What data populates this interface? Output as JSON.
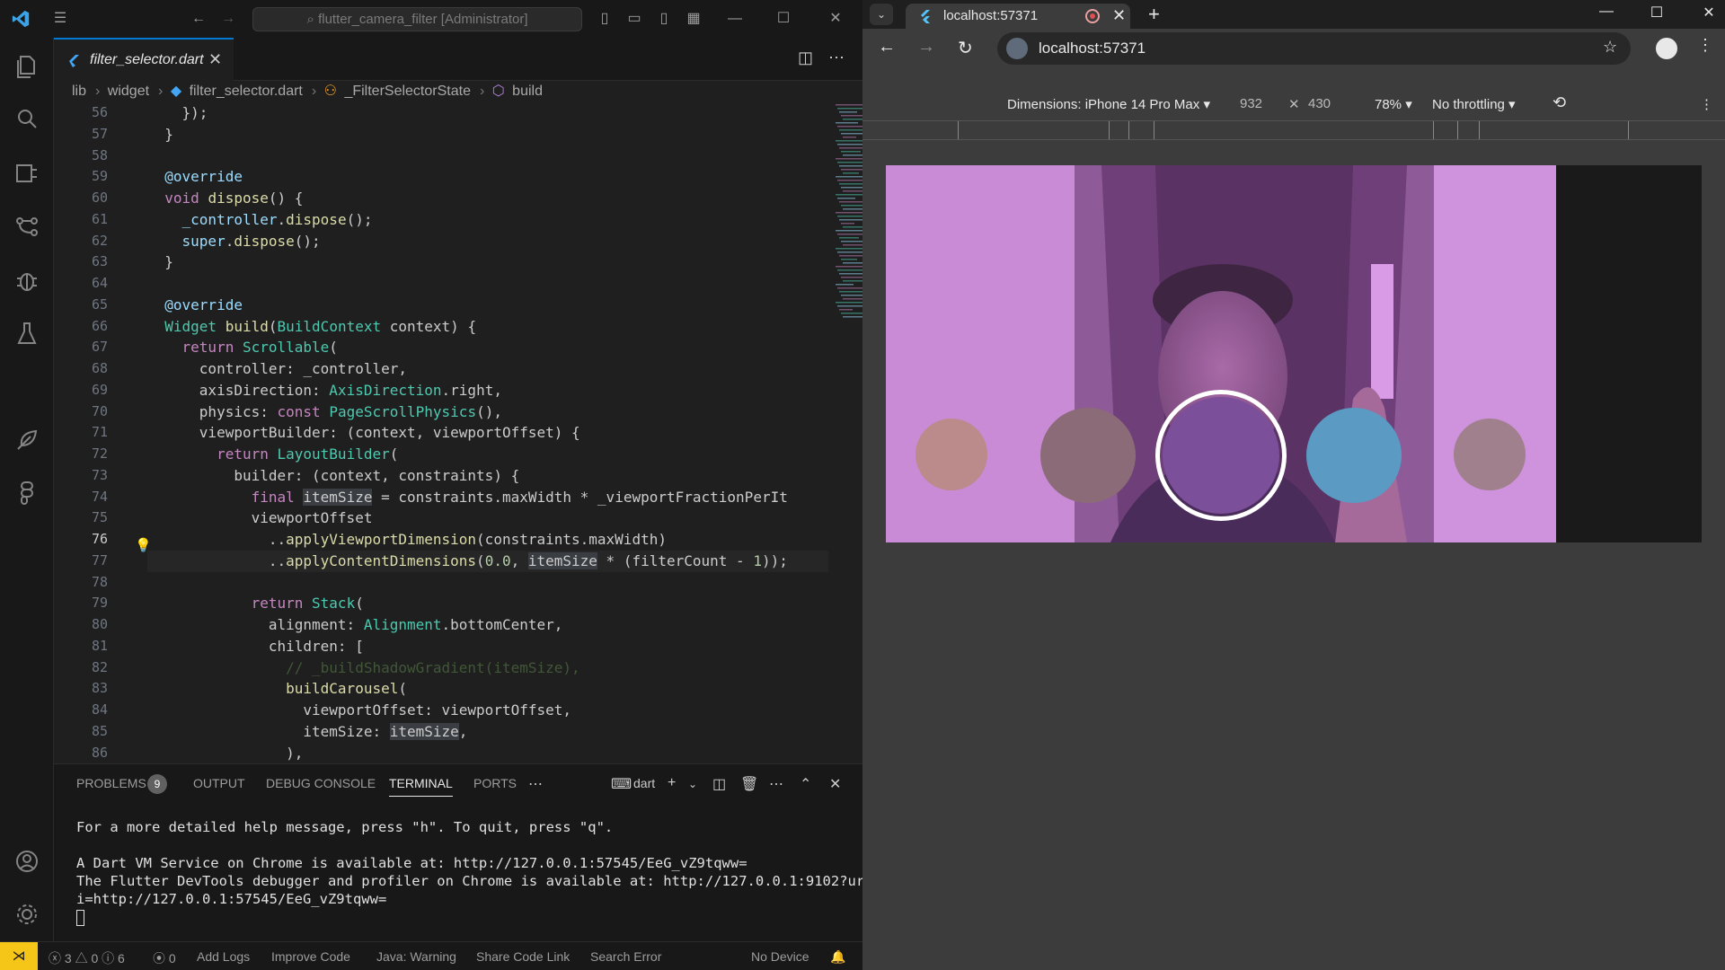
{
  "vscode": {
    "title_search": "flutter_camera_filter [Administrator]",
    "tab": {
      "filename": "filter_selector.dart"
    },
    "breadcrumb": [
      "lib",
      "widget",
      "filter_selector.dart",
      "_FilterSelectorState",
      "build"
    ],
    "line_numbers": [
      "56",
      "57",
      "58",
      "59",
      "60",
      "61",
      "62",
      "63",
      "64",
      "65",
      "66",
      "67",
      "68",
      "69",
      "70",
      "71",
      "72",
      "73",
      "74",
      "75",
      "76",
      "77",
      "78",
      "79",
      "80",
      "81",
      "82",
      "83",
      "84",
      "85",
      "86"
    ],
    "current_line": "76",
    "panel": {
      "tabs": [
        "PROBLEMS",
        "OUTPUT",
        "DEBUG CONSOLE",
        "TERMINAL",
        "PORTS"
      ],
      "problems_count": "9",
      "terminal_shell": "dart",
      "terminal_lines": [
        "For a more detailed help message, press \"h\". To quit, press \"q\".",
        "",
        "A Dart VM Service on Chrome is available at: http://127.0.0.1:57545/EeG_vZ9tqww=",
        "The Flutter DevTools debugger and profiler on Chrome is available at: http://127.0.0.1:9102?ur",
        "i=http://127.0.0.1:57545/EeG_vZ9tqww="
      ]
    },
    "status": {
      "errors": "3",
      "warnings": "0",
      "info": "6",
      "ports": "0",
      "items": [
        "Add Logs",
        "Improve Code",
        "Java: Warning",
        "Share Code Link",
        "Search Error"
      ],
      "device": "No Device"
    }
  },
  "chrome": {
    "tab_title": "localhost:57371",
    "url": "localhost:57371",
    "devtools": {
      "dimensions_label": "Dimensions: iPhone 14 Pro Max",
      "width": "932",
      "height": "430",
      "zoom": "78%",
      "throttling": "No throttling"
    }
  },
  "colors": {
    "accent": "#0078d4",
    "status_remote": "#f5c518",
    "camera_tint": "#c27fd0"
  }
}
